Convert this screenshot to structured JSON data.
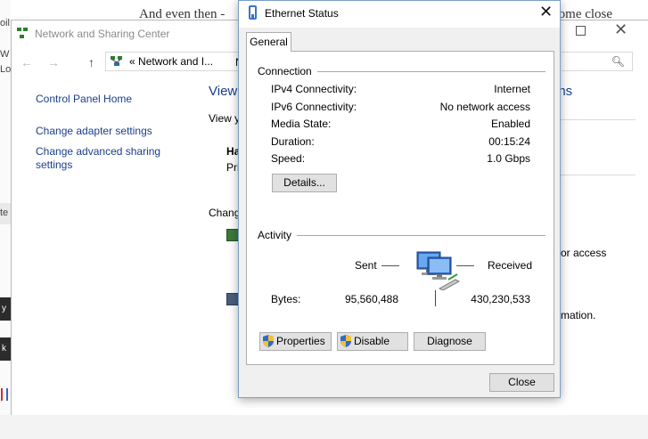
{
  "background_page": {
    "headline_left": "And even then -",
    "headline_right": "come close",
    "fragments": [
      "oil",
      "W",
      "Lo",
      "te",
      "y t",
      "k R"
    ]
  },
  "network_center": {
    "title": "Network and Sharing Center",
    "address_chevron": "«",
    "address_text": "Network and I...",
    "address_extra": "N",
    "nav_back": "←",
    "nav_forward": "→",
    "nav_up": "↑",
    "sidebar_links": [
      "Control Panel Home",
      "Change adapter settings",
      "Change advanced sharing settings"
    ],
    "fragments": {
      "view_heading": "View",
      "view_sub": "View y",
      "ha": "Ha",
      "pri": "Pri",
      "change": "Chang",
      "ons": "ons",
      "er_access": "er or access",
      "information": "formation."
    }
  },
  "dialog": {
    "title": "Ethernet Status",
    "close_glyph": "✕",
    "tab": "General",
    "connection": {
      "label": "Connection",
      "rows": [
        {
          "label": "IPv4 Connectivity:",
          "value": "Internet"
        },
        {
          "label": "IPv6 Connectivity:",
          "value": "No network access"
        },
        {
          "label": "Media State:",
          "value": "Enabled"
        },
        {
          "label": "Duration:",
          "value": "00:15:24"
        },
        {
          "label": "Speed:",
          "value": "1.0 Gbps"
        }
      ],
      "details_button": "Details..."
    },
    "activity": {
      "label": "Activity",
      "sent_label": "Sent",
      "received_label": "Received",
      "bytes_label": "Bytes:",
      "bytes_sent": "95,560,488",
      "bytes_received": "430,230,533"
    },
    "buttons": {
      "properties": "Properties",
      "disable": "Disable",
      "diagnose": "Diagnose",
      "close": "Close"
    }
  },
  "colors": {
    "link": "#1a3e8c",
    "dialog_border": "#7a9fc9",
    "button_face": "#e1e1e1",
    "shield_blue": "#2f6bc9",
    "shield_yellow": "#f2c230"
  }
}
